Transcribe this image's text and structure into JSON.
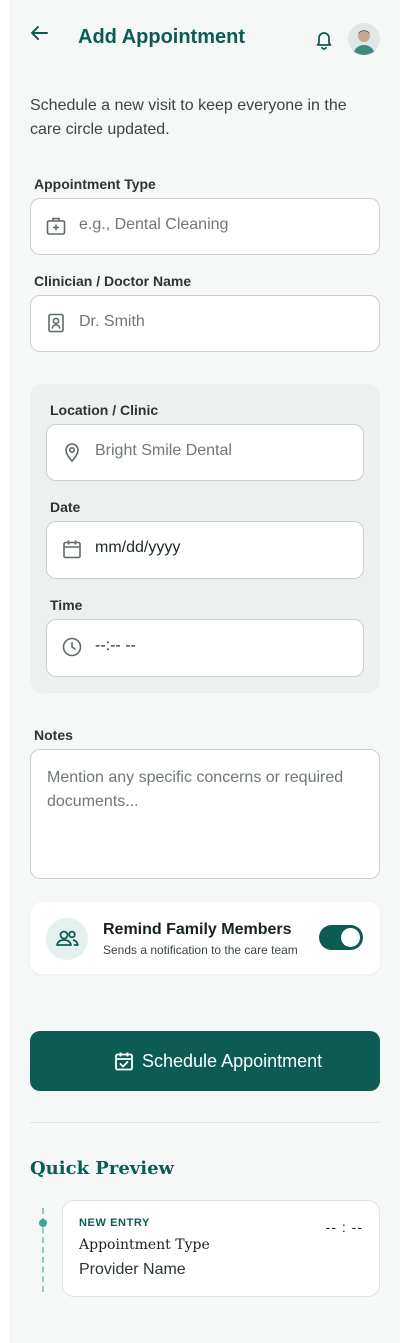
{
  "header": {
    "title": "Add Appointment",
    "back_icon": "arrow-left-icon",
    "bell_icon": "bell-icon",
    "avatar_icon": "user-avatar"
  },
  "intro": "Schedule a new visit to keep everyone in the care circle updated.",
  "form": {
    "appointment_type": {
      "label": "Appointment Type",
      "placeholder": "e.g., Dental Cleaning",
      "icon": "medical-bag-icon"
    },
    "clinician": {
      "label": "Clinician / Doctor Name",
      "placeholder": "Dr. Smith",
      "icon": "id-badge-icon"
    },
    "location": {
      "label": "Location / Clinic",
      "placeholder": "Bright Smile Dental",
      "icon": "map-pin-icon"
    },
    "date": {
      "label": "Date",
      "value": "mm/dd/yyyy",
      "icon": "calendar-icon"
    },
    "time": {
      "label": "Time",
      "value": "--:-- --",
      "icon": "clock-icon"
    },
    "notes": {
      "label": "Notes",
      "placeholder": "Mention any specific concerns or required documents..."
    }
  },
  "remind": {
    "title": "Remind Family Members",
    "subtitle": "Sends a notification to the care team",
    "icon": "group-icon",
    "enabled": true
  },
  "primary_button": {
    "label": "Schedule Appointment",
    "icon": "calendar-check-icon"
  },
  "quick_preview": {
    "title": "Quick Preview",
    "badge": "NEW ENTRY",
    "time": "-- : --",
    "type": "Appointment Type",
    "provider": "Provider Name"
  },
  "colors": {
    "accent": "#0d5c54",
    "background": "#f5f8f7",
    "group_background": "#ecf0ef"
  }
}
